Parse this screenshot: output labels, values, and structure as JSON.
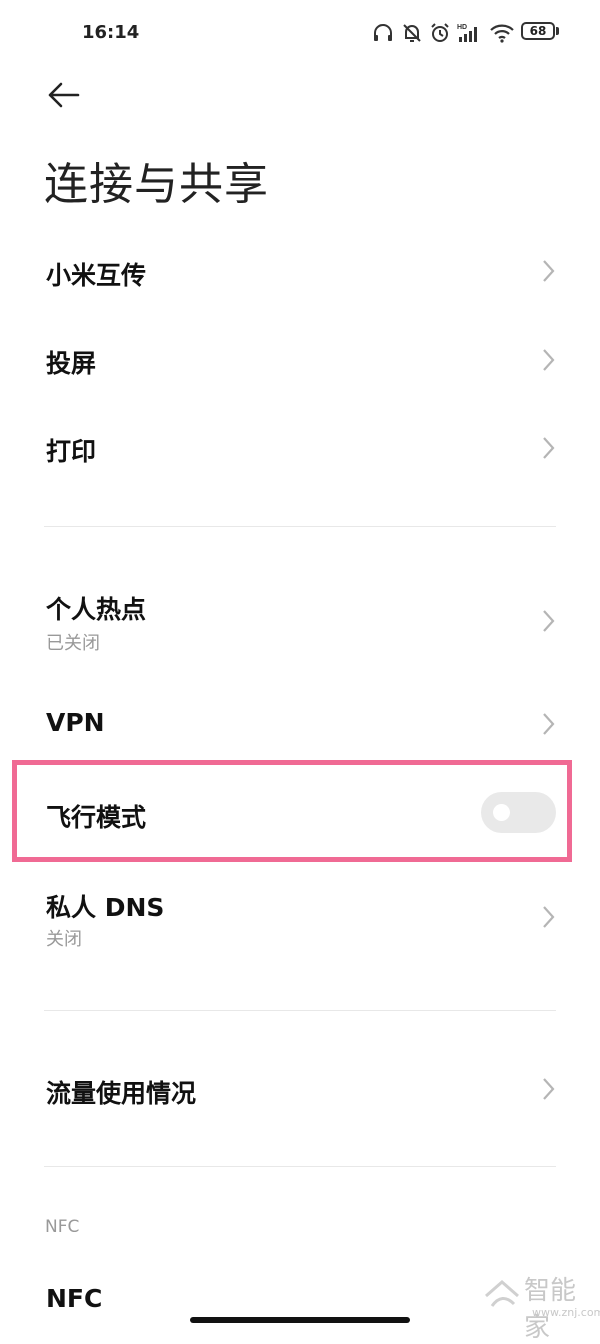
{
  "status_bar": {
    "time": "16:14",
    "battery": "68"
  },
  "page": {
    "title": "连接与共享"
  },
  "items": {
    "mi_share": {
      "label": "小米互传"
    },
    "cast": {
      "label": "投屏"
    },
    "print": {
      "label": "打印"
    },
    "hotspot": {
      "label": "个人热点",
      "status": "已关闭"
    },
    "vpn": {
      "label": "VPN"
    },
    "airplane": {
      "label": "飞行模式",
      "enabled": false
    },
    "private_dns": {
      "label": "私人 DNS",
      "status": "关闭"
    },
    "data_usage": {
      "label": "流量使用情况"
    },
    "nfc_section": {
      "label": "NFC"
    },
    "nfc": {
      "label": "NFC"
    }
  },
  "watermark": {
    "text": "智能家",
    "url": "www.znj.com"
  },
  "colors": {
    "highlight": "#f06a94",
    "chevron": "#b5b5b5",
    "toggle_off": "#e9e9e9"
  }
}
